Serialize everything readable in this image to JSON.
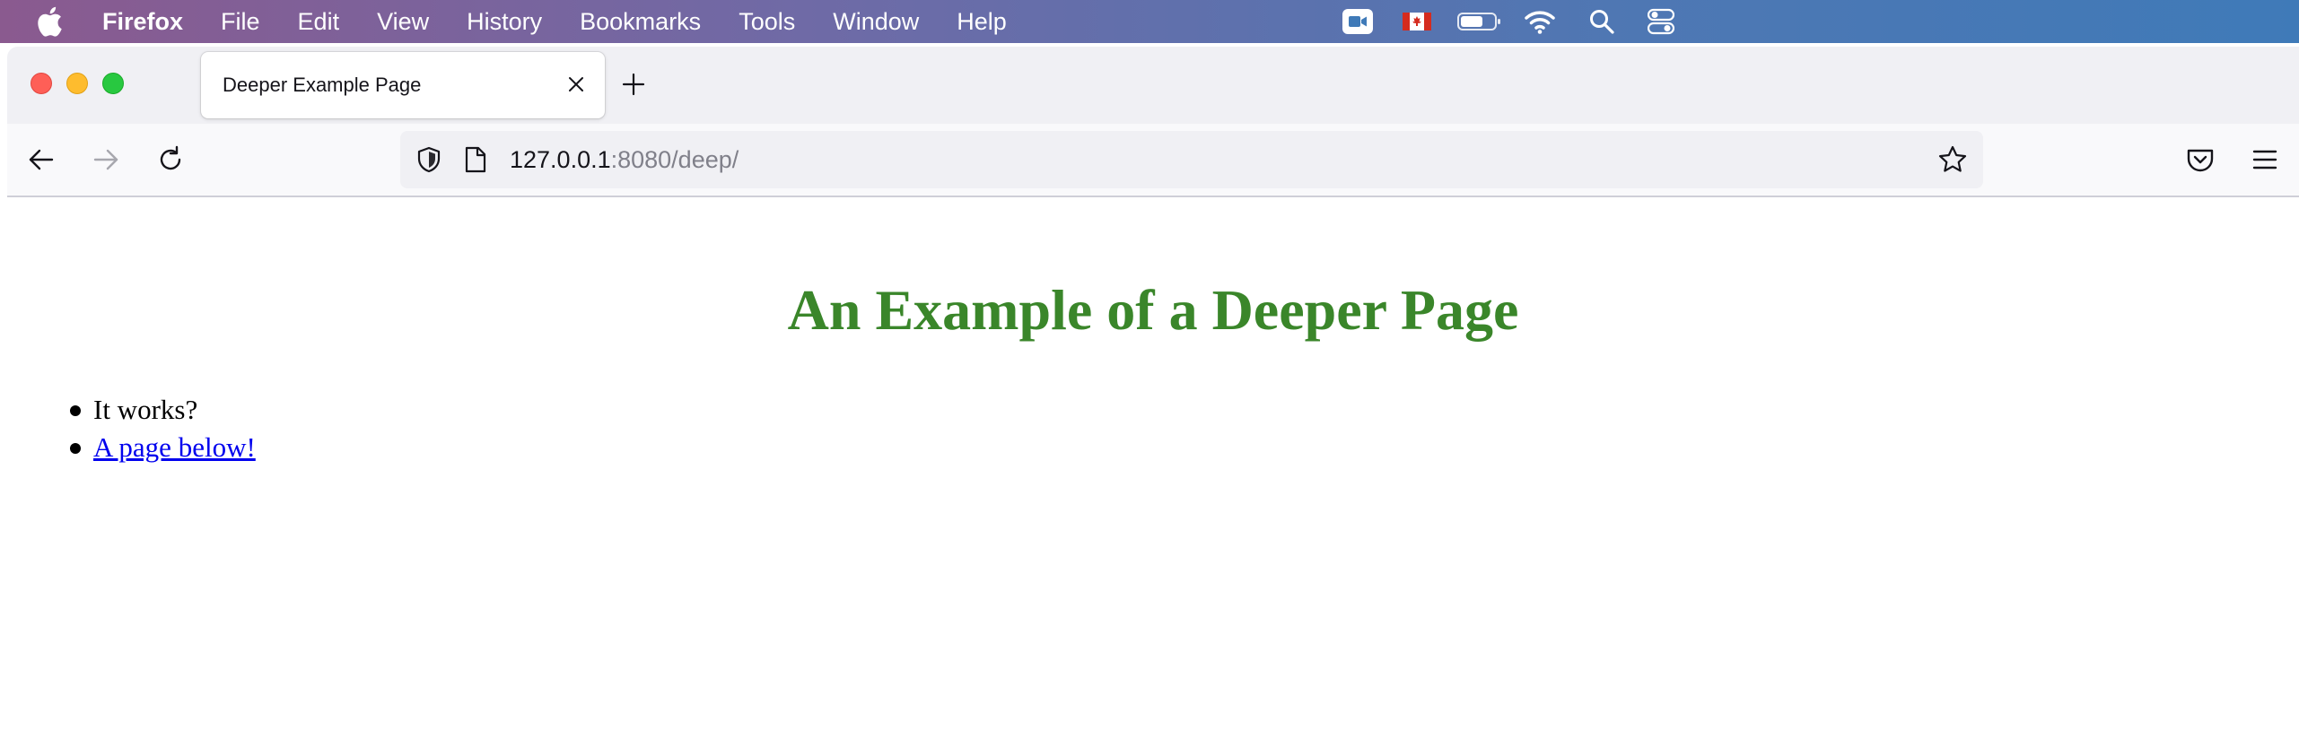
{
  "menubar": {
    "app_name": "Firefox",
    "items": [
      "File",
      "Edit",
      "View",
      "History",
      "Bookmarks",
      "Tools",
      "Window",
      "Help"
    ],
    "status_icons": [
      "video-camera-icon",
      "canada-flag-icon",
      "battery-icon",
      "wifi-icon",
      "spotlight-search-icon",
      "control-center-icon"
    ]
  },
  "browser": {
    "tab": {
      "title": "Deeper Example Page"
    },
    "url": {
      "host": "127.0.0.1",
      "rest": ":8080/deep/"
    }
  },
  "page": {
    "heading": "An Example of a Deeper Page",
    "heading_color": "#3a862a",
    "list": [
      {
        "text": "It works?"
      },
      {
        "text": "A page below!"
      }
    ],
    "link_color": "#0000ee"
  }
}
